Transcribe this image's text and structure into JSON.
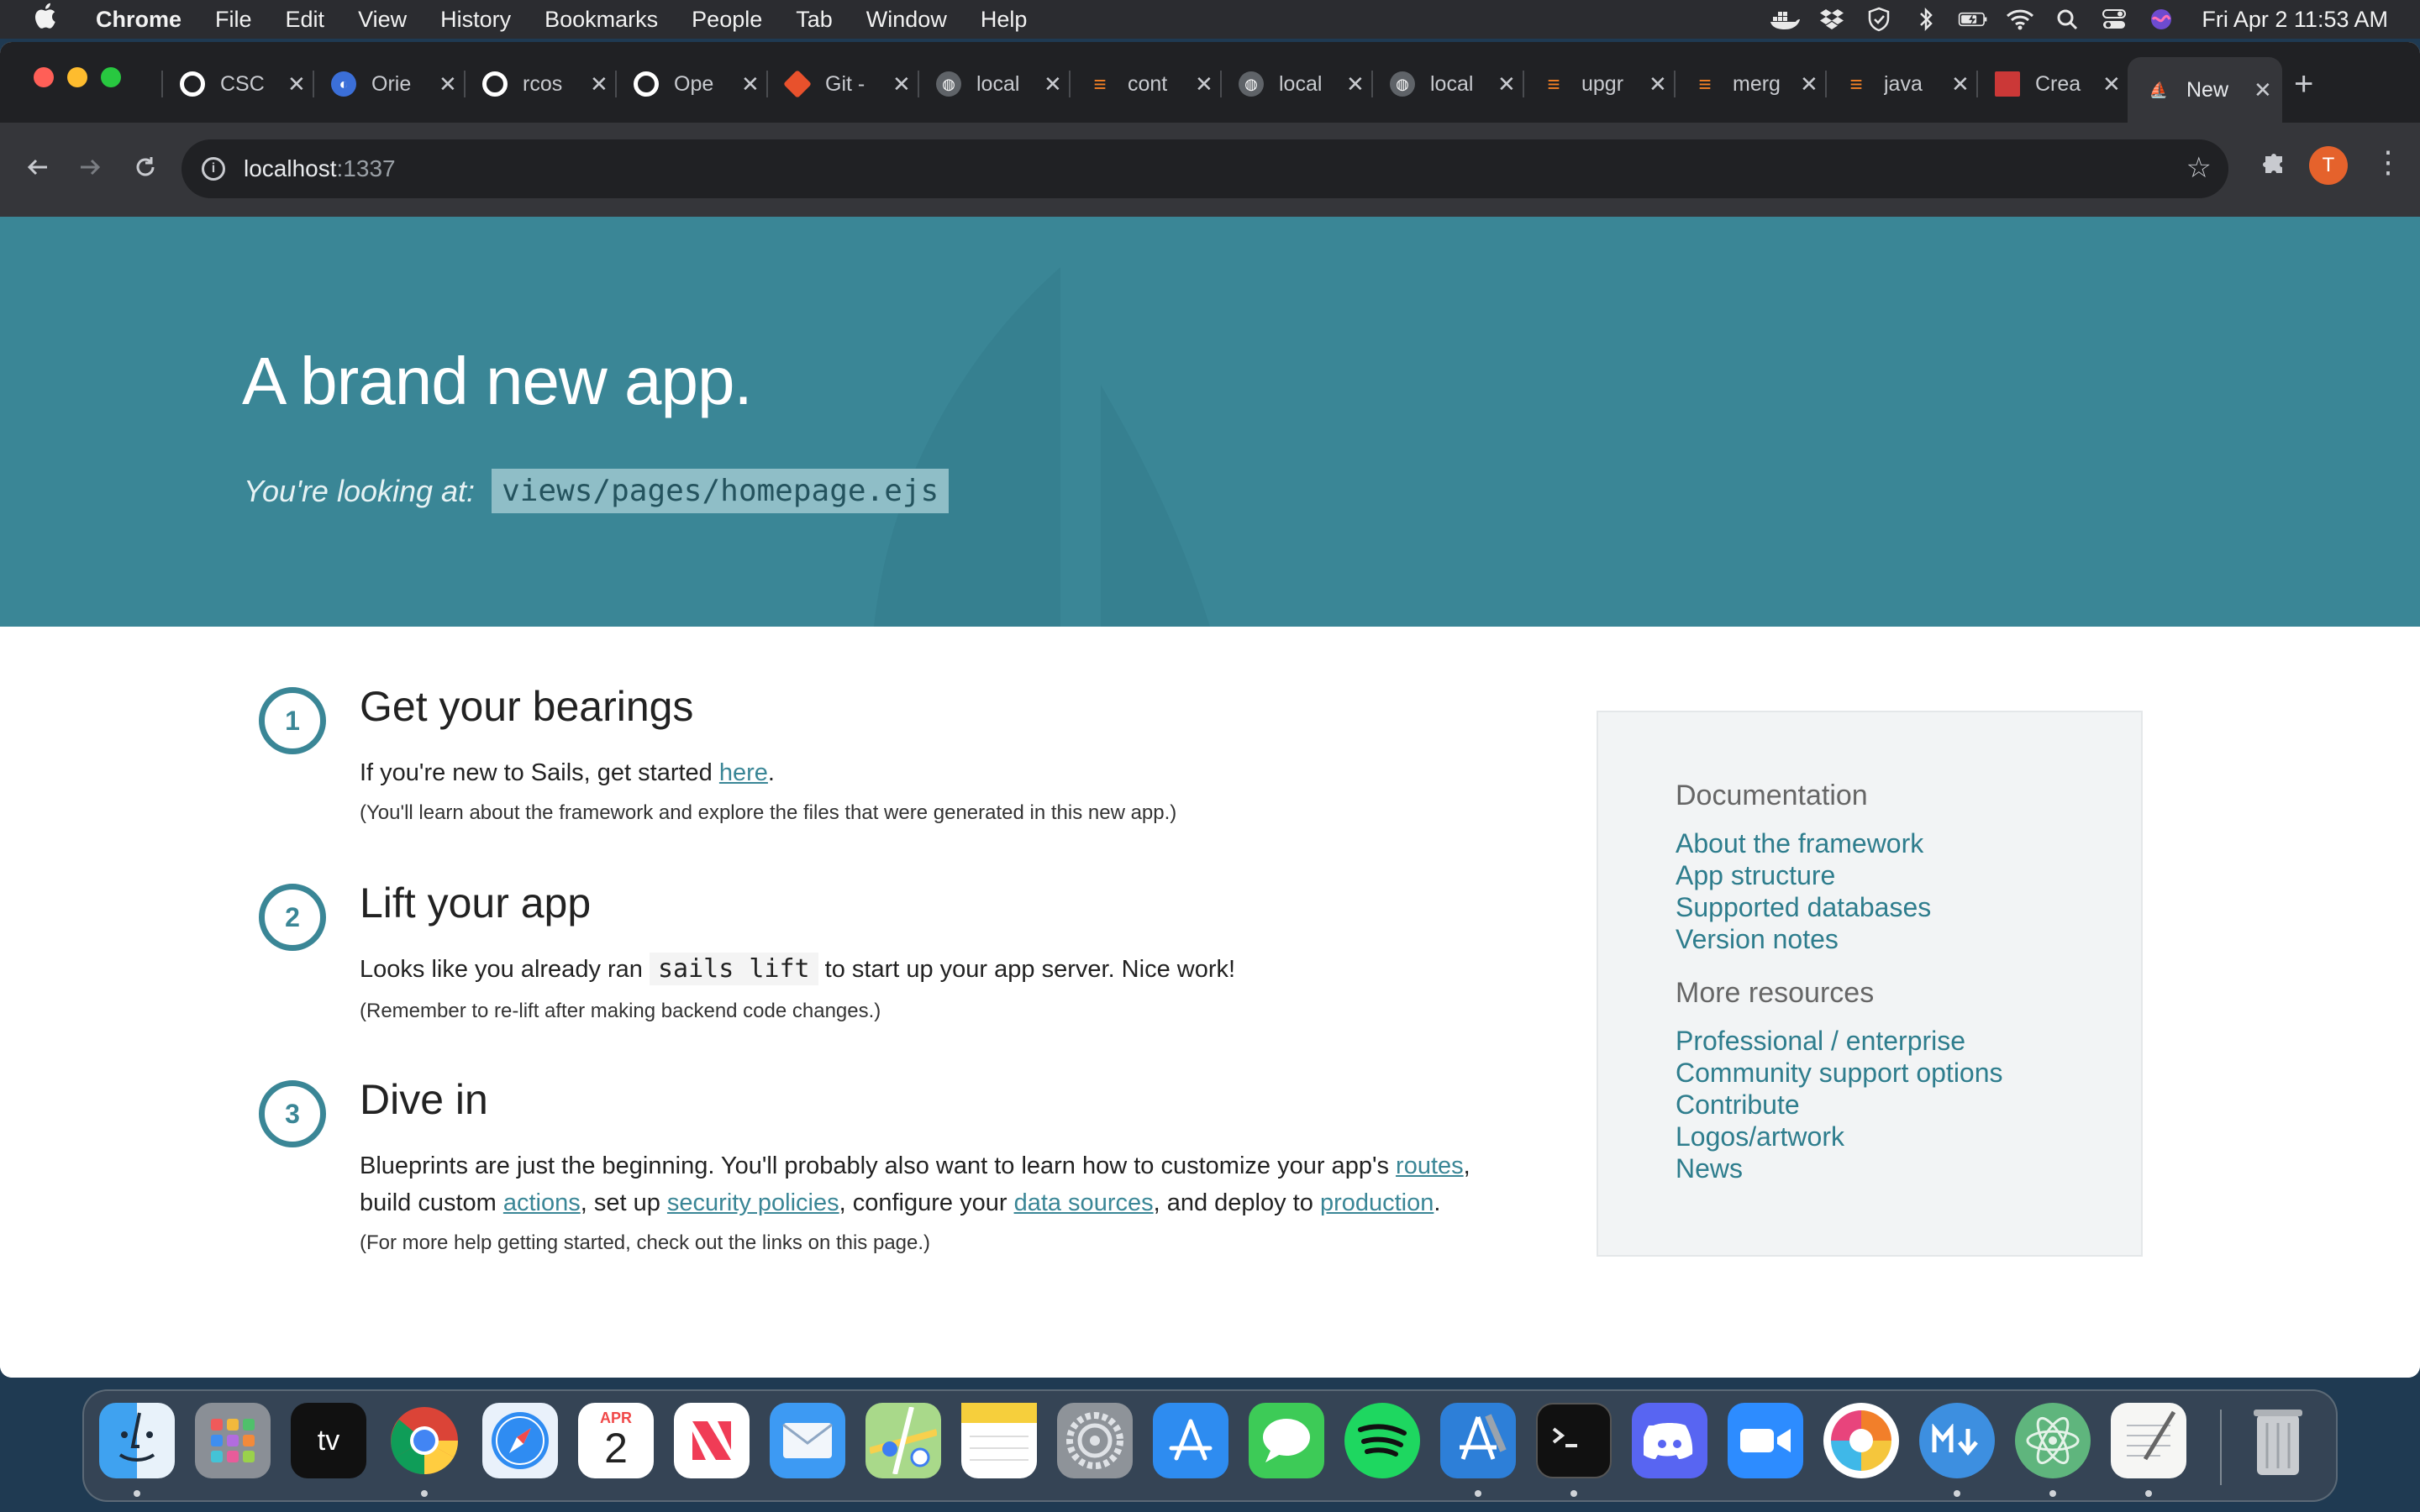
{
  "menubar": {
    "apple": "",
    "items": [
      "Chrome",
      "File",
      "Edit",
      "View",
      "History",
      "Bookmarks",
      "People",
      "Tab",
      "Window",
      "Help"
    ],
    "clock": "Fri Apr 2  11:53 AM"
  },
  "tabs": [
    {
      "label": "CSC",
      "icon": "github-icon",
      "color": "#202124"
    },
    {
      "label": "Orie",
      "icon": "orientation-icon",
      "color": "#3b6fd8"
    },
    {
      "label": "rcos",
      "icon": "github-icon",
      "color": "#202124"
    },
    {
      "label": "Ope",
      "icon": "github-icon",
      "color": "#202124"
    },
    {
      "label": "Git -",
      "icon": "git-icon",
      "color": "#e8512c"
    },
    {
      "label": "local",
      "icon": "globe-icon",
      "color": "#5f6368"
    },
    {
      "label": "cont",
      "icon": "stackoverflow-icon",
      "color": "#f48024"
    },
    {
      "label": "local",
      "icon": "globe-icon",
      "color": "#5f6368"
    },
    {
      "label": "local",
      "icon": "globe-icon",
      "color": "#5f6368"
    },
    {
      "label": "upgr",
      "icon": "stackoverflow-icon",
      "color": "#f48024"
    },
    {
      "label": "merg",
      "icon": "stackoverflow-icon",
      "color": "#f48024"
    },
    {
      "label": "java",
      "icon": "stackoverflow-icon",
      "color": "#f48024"
    },
    {
      "label": "Crea",
      "icon": "npm-icon",
      "color": "#cb3837"
    },
    {
      "label": "New",
      "icon": "sails-icon",
      "color": "#3a8696",
      "active": true
    }
  ],
  "toolbar": {
    "url_host": "localhost",
    "url_port": ":1337",
    "profile_initial": "T"
  },
  "hero": {
    "title": "A brand new app.",
    "subtitle": "You're looking at:",
    "path": "views/pages/homepage.ejs"
  },
  "steps": [
    {
      "number": "1",
      "title": "Get your bearings",
      "text_before": "If you're new to Sails, get started ",
      "link": "here",
      "text_after": ".",
      "note": "(You'll learn about the framework and explore the files that were generated in this new app.)"
    },
    {
      "number": "2",
      "title": "Lift your app",
      "text_before": "Looks like you already ran ",
      "code": "sails lift",
      "text_after": " to start up your app server. Nice work!",
      "note": "(Remember to re-lift after making backend code changes.)"
    },
    {
      "number": "3",
      "title": "Dive in",
      "text_1": "Blueprints are just the beginning. You'll probably also want to learn how to customize your app's ",
      "link_routes": "routes",
      "text_2": ",",
      "text_3": "build custom ",
      "link_actions": "actions",
      "text_4": ", set up ",
      "link_policies": "security policies",
      "text_5": ", configure your ",
      "link_data": "data sources",
      "text_6": ", and deploy to ",
      "link_production": "production",
      "text_7": ".",
      "note": "(For more help getting started, check out the links on this page.)"
    }
  ],
  "sidebar": {
    "doc_heading": "Documentation",
    "doc_links": [
      "About the framework",
      "App structure",
      "Supported databases",
      "Version notes"
    ],
    "res_heading": "More resources",
    "res_links": [
      "Professional / enterprise",
      "Community support options",
      "Contribute",
      "Logos/artwork",
      "News"
    ]
  },
  "dock": {
    "calendar_month": "APR",
    "calendar_day": "2",
    "tv_label": "tv",
    "apps": [
      "Finder",
      "Launchpad",
      "Apple TV",
      "Chrome",
      "Safari",
      "Calendar",
      "News",
      "Mail",
      "Maps",
      "Notes",
      "System Preferences",
      "App Store",
      "Messages",
      "Spotify",
      "Xcode",
      "Terminal",
      "Discord",
      "Zoom",
      "Chromatic",
      "MacDown",
      "Atom",
      "TextEdit",
      "Trash"
    ]
  }
}
